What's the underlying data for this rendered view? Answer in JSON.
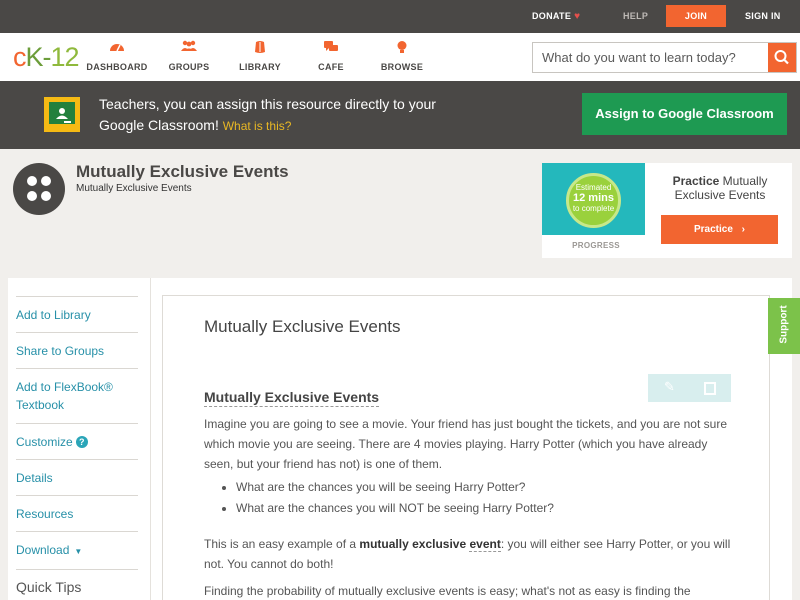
{
  "topbar": {
    "donate": "DONATE",
    "help": "HELP",
    "join": "JOIN",
    "signin": "SIGN IN"
  },
  "logo": {
    "c": "c",
    "k": "K",
    "dash": "-",
    "n12": "12"
  },
  "nav": {
    "items": [
      {
        "label": "DASHBOARD",
        "icon": "dashboard-icon"
      },
      {
        "label": "GROUPS",
        "icon": "groups-icon"
      },
      {
        "label": "LIBRARY",
        "icon": "library-icon"
      },
      {
        "label": "CAFE",
        "icon": "cafe-icon"
      },
      {
        "label": "BROWSE",
        "icon": "browse-icon"
      }
    ],
    "search_placeholder": "What do you want to learn today?"
  },
  "classroom_banner": {
    "text": "Teachers, you can assign this resource directly to your Google Classroom!",
    "what": "What is this?",
    "button": "Assign to Google Classroom"
  },
  "header": {
    "title": "Mutually Exclusive Events",
    "subtitle": "Mutually Exclusive Events"
  },
  "practice": {
    "estimated": "Estimated",
    "mins": "12 mins",
    "complete": "to complete",
    "progress_label": "PROGRESS",
    "title_bold": "Practice",
    "title_rest": "Mutually Exclusive Events",
    "button": "Practice"
  },
  "sidebar": {
    "items": [
      {
        "label": "Add to Library"
      },
      {
        "label": "Share to Groups"
      },
      {
        "label": "Add to FlexBook® Textbook"
      },
      {
        "label": "Customize"
      },
      {
        "label": "Details"
      },
      {
        "label": "Resources"
      },
      {
        "label": "Download"
      }
    ],
    "quick_tips": "Quick Tips"
  },
  "content": {
    "heading": "Mutually Exclusive Events",
    "subheading": "Mutually Exclusive Events",
    "p1": "Imagine you are going to see a movie. Your friend has just bought the tickets, and you are not sure which movie you are seeing. There are 4 movies playing. Harry Potter (which you have already seen, but your friend has not) is one of them.",
    "bullets": [
      "What are the chances you will be seeing Harry Potter?",
      "What are the chances you will NOT be seeing Harry Potter?"
    ],
    "p2_a": "This is an easy example of a ",
    "p2_bold1": "mutually exclusive",
    "p2_bold2": "event",
    "p2_b": ": you will either see Harry Potter, or you will not. You cannot do both!",
    "p3": "Finding the probability of mutually exclusive events is easy; what's not as easy is finding the"
  },
  "support": "Support",
  "colors": {
    "accent": "#f26530",
    "dark": "#4a4846",
    "link": "#2790a8",
    "google_green": "#1e9a52",
    "support_green": "#7cc24a"
  }
}
